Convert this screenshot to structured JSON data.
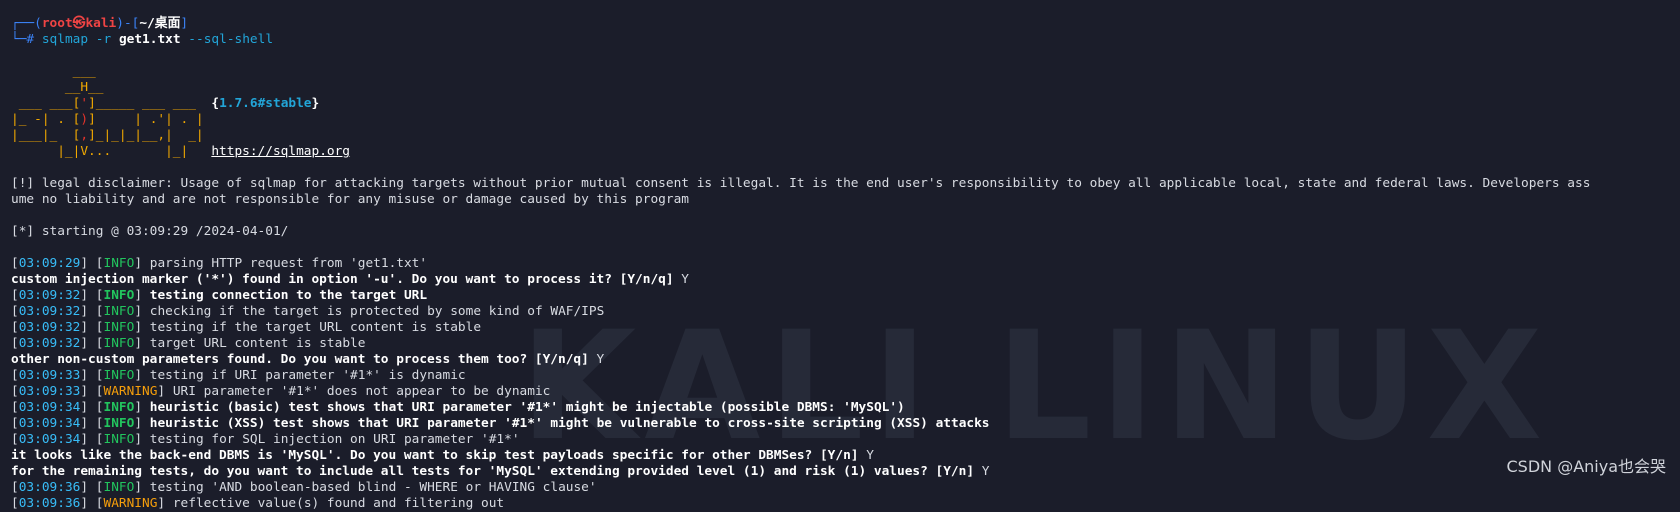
{
  "prompt": {
    "box_open": "┌──(",
    "user_host": "root㉿kali",
    "box_mid": ")-[",
    "path": "~/桌面",
    "box_close": "]",
    "hash": "└─#",
    "cmd": "sqlmap",
    "args_a": "-r",
    "file": "get1.txt",
    "args_b": "--sql-shell"
  },
  "logo": {
    "line1": "        ___",
    "line2": "       __H__",
    "line3a": " ___ ___[",
    "line3b": "'",
    "line3c": "]_____ ___ ___  ",
    "version_open": "{",
    "version": "1.7.6#stable",
    "version_close": "}",
    "line4a": "|_ -| . [",
    "line4b": ")",
    "line4c": "]     | .'| . |",
    "line5a": "|___|_  [",
    "line5b": ",",
    "line5c": "]_|_|_|__,|  _|",
    "line6": "      |_|V...       |_|   ",
    "url": "https://sqlmap.org"
  },
  "disclaimer": [
    "[!] legal disclaimer: Usage of sqlmap for attacking targets without prior mutual consent is illegal. It is the end user's responsibility to obey all applicable local, state and federal laws. Developers ass",
    "ume no liability and are not responsible for any misuse or damage caused by this program"
  ],
  "starting": "[*] starting @ 03:09:29 /2024-04-01/",
  "log": [
    {
      "ts": "03:09:29",
      "lvl": "INFO",
      "msg": " parsing HTTP request from 'get1.txt'"
    },
    {
      "q": "custom injection marker ('*') found in option '-u'. Do you want to process it? [Y/n/q]",
      "a": " Y"
    },
    {
      "ts": "03:09:32",
      "lvl": "INFO",
      "msg": " testing connection to the target URL"
    },
    {
      "ts": "03:09:32",
      "lvl": "INFO",
      "msg": " checking if the target is protected by some kind of WAF/IPS"
    },
    {
      "ts": "03:09:32",
      "lvl": "INFO",
      "msg": " testing if the target URL content is stable"
    },
    {
      "ts": "03:09:32",
      "lvl": "INFO",
      "msg": " target URL content is stable"
    },
    {
      "q": "other non-custom parameters found. Do you want to process them too? [Y/n/q]",
      "a": " Y"
    },
    {
      "ts": "03:09:33",
      "lvl": "INFO",
      "msg": " testing if URI parameter '#1*' is dynamic"
    },
    {
      "ts": "03:09:33",
      "lvl": "WARNING",
      "msg": " URI parameter '#1*' does not appear to be dynamic"
    },
    {
      "ts": "03:09:34",
      "lvl": "INFO",
      "msg": " heuristic (basic) test shows that URI parameter '#1*' might be injectable (possible DBMS: 'MySQL')"
    },
    {
      "ts": "03:09:34",
      "lvl": "INFO",
      "msg": " heuristic (XSS) test shows that URI parameter '#1*' might be vulnerable to cross-site scripting (XSS) attacks"
    },
    {
      "ts": "03:09:34",
      "lvl": "INFO",
      "msg": " testing for SQL injection on URI parameter '#1*'"
    },
    {
      "q": "it looks like the back-end DBMS is 'MySQL'. Do you want to skip test payloads specific for other DBMSes? [Y/n]",
      "a": " Y"
    },
    {
      "q": "for the remaining tests, do you want to include all tests for 'MySQL' extending provided level (1) and risk (1) values? [Y/n]",
      "a": " Y"
    },
    {
      "ts": "03:09:36",
      "lvl": "INFO",
      "msg": " testing 'AND boolean-based blind - WHERE or HAVING clause'"
    },
    {
      "ts": "03:09:36",
      "lvl": "WARNING",
      "msg": " reflective value(s) found and filtering out"
    }
  ],
  "watermark_text": "KALI LINUX",
  "csdn_mark": "CSDN @Aniya也会哭"
}
